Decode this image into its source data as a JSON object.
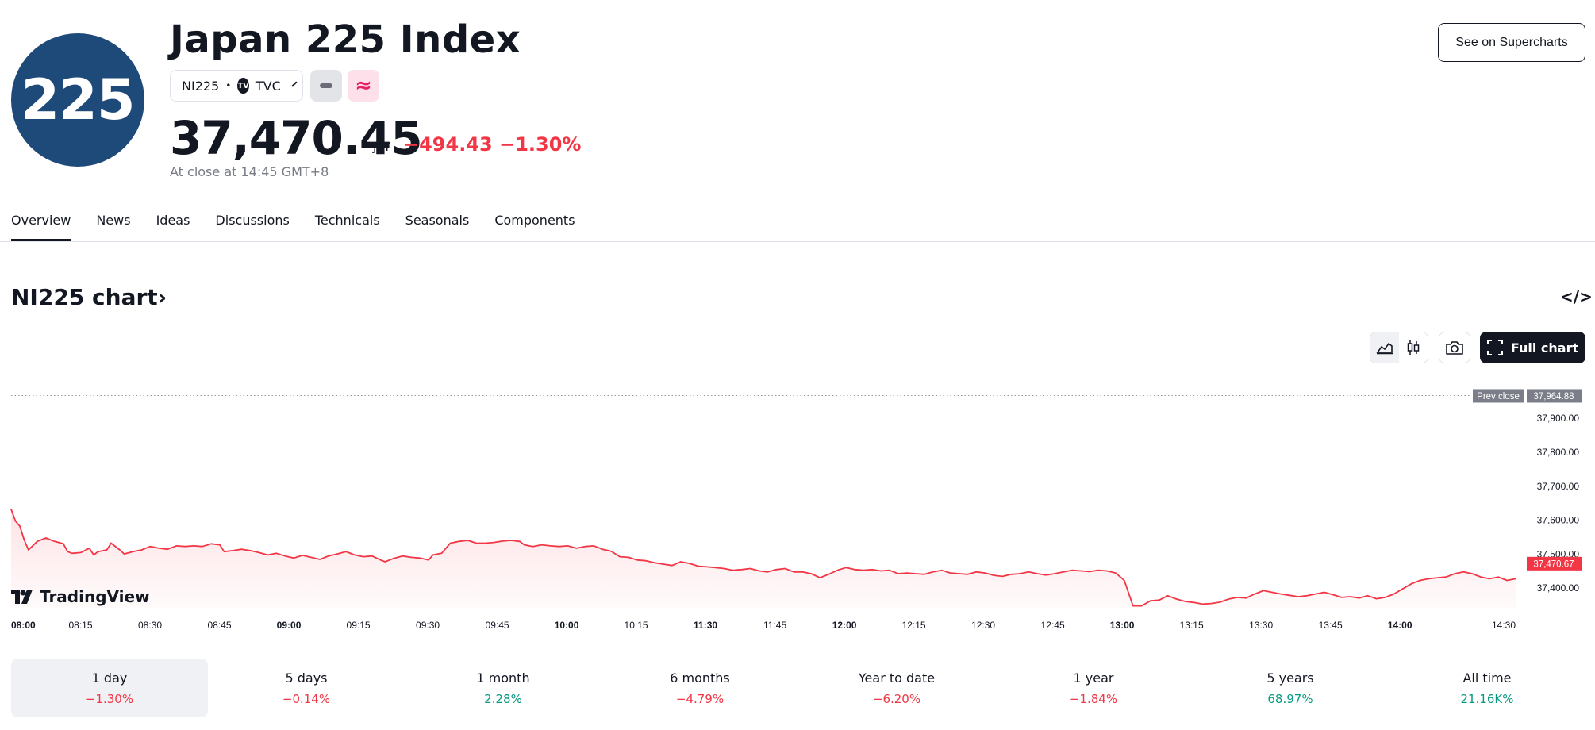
{
  "header": {
    "logo_text": "225",
    "title": "Japan 225 Index",
    "symbol": "NI225",
    "separator": "•",
    "exchange_icon": "TV",
    "exchange": "TVC",
    "supercharts_button": "See on Supercharts"
  },
  "quote": {
    "price": "37,470.45",
    "currency": "JPY",
    "change": "−494.43",
    "change_pct": "−1.30%",
    "close_note": "At close at 14:45 GMT+8",
    "accent_negative": "#f23645",
    "accent_positive": "#089981"
  },
  "tabs": [
    {
      "label": "Overview",
      "active": true
    },
    {
      "label": "News"
    },
    {
      "label": "Ideas"
    },
    {
      "label": "Discussions"
    },
    {
      "label": "Technicals"
    },
    {
      "label": "Seasonals"
    },
    {
      "label": "Components"
    }
  ],
  "chart_section": {
    "title": "NI225 chart›",
    "embed_icon": "</>",
    "full_chart_button": "Full chart",
    "watermark": "TradingView"
  },
  "chart_data": {
    "type": "area",
    "line_color": "#f23645",
    "prev_close_label": "Prev close",
    "prev_close_value": "37,964.88",
    "prev_close": 37964.88,
    "last_label": "37,470.67",
    "last": 37470.67,
    "ylim": [
      37330,
      37980
    ],
    "y_ticks": [
      {
        "value": 37900,
        "label": "37,900.00"
      },
      {
        "value": 37800,
        "label": "37,800.00"
      },
      {
        "value": 37700,
        "label": "37,700.00"
      },
      {
        "value": 37600,
        "label": "37,600.00"
      },
      {
        "value": 37500,
        "label": "37,500.00"
      },
      {
        "value": 37400,
        "label": "37,400.00"
      }
    ],
    "x_ticks": [
      {
        "t": 0,
        "label": "08:00",
        "bold": true
      },
      {
        "t": 15,
        "label": "08:15"
      },
      {
        "t": 30,
        "label": "08:30"
      },
      {
        "t": 45,
        "label": "08:45"
      },
      {
        "t": 60,
        "label": "09:00",
        "bold": true
      },
      {
        "t": 75,
        "label": "09:15"
      },
      {
        "t": 90,
        "label": "09:30"
      },
      {
        "t": 105,
        "label": "09:45"
      },
      {
        "t": 120,
        "label": "10:00",
        "bold": true
      },
      {
        "t": 135,
        "label": "10:15"
      },
      {
        "t": 150,
        "label": "11:30",
        "bold": true
      },
      {
        "t": 165,
        "label": "11:45"
      },
      {
        "t": 180,
        "label": "12:00",
        "bold": true
      },
      {
        "t": 195,
        "label": "12:15"
      },
      {
        "t": 210,
        "label": "12:30"
      },
      {
        "t": 225,
        "label": "12:45"
      },
      {
        "t": 240,
        "label": "13:00",
        "bold": true
      },
      {
        "t": 255,
        "label": "13:15"
      },
      {
        "t": 270,
        "label": "13:30"
      },
      {
        "t": 285,
        "label": "13:45"
      },
      {
        "t": 300,
        "label": "14:00",
        "bold": true
      },
      {
        "t": 325,
        "label": "14:30"
      }
    ],
    "x_range": [
      0,
      325
    ],
    "series": [
      {
        "values": [
          [
            0,
            37630
          ],
          [
            1,
            37595
          ],
          [
            2,
            37580
          ],
          [
            3,
            37540
          ],
          [
            4,
            37510
          ],
          [
            6,
            37535
          ],
          [
            8,
            37545
          ],
          [
            10,
            37535
          ],
          [
            12,
            37528
          ],
          [
            13,
            37505
          ],
          [
            14,
            37500
          ],
          [
            16,
            37502
          ],
          [
            18,
            37515
          ],
          [
            19,
            37495
          ],
          [
            20,
            37505
          ],
          [
            22,
            37510
          ],
          [
            23,
            37530
          ],
          [
            25,
            37510
          ],
          [
            26,
            37498
          ],
          [
            28,
            37505
          ],
          [
            30,
            37510
          ],
          [
            32,
            37520
          ],
          [
            34,
            37515
          ],
          [
            36,
            37512
          ],
          [
            38,
            37522
          ],
          [
            40,
            37520
          ],
          [
            42,
            37522
          ],
          [
            44,
            37520
          ],
          [
            46,
            37528
          ],
          [
            48,
            37525
          ],
          [
            49,
            37505
          ],
          [
            51,
            37508
          ],
          [
            53,
            37512
          ],
          [
            55,
            37508
          ],
          [
            57,
            37502
          ],
          [
            59,
            37495
          ],
          [
            61,
            37500
          ],
          [
            63,
            37492
          ],
          [
            65,
            37486
          ],
          [
            67,
            37494
          ],
          [
            69,
            37488
          ],
          [
            71,
            37482
          ],
          [
            73,
            37492
          ],
          [
            75,
            37498
          ],
          [
            77,
            37505
          ],
          [
            79,
            37495
          ],
          [
            81,
            37490
          ],
          [
            83,
            37492
          ],
          [
            85,
            37480
          ],
          [
            86,
            37475
          ],
          [
            88,
            37485
          ],
          [
            90,
            37492
          ],
          [
            92,
            37488
          ],
          [
            94,
            37486
          ],
          [
            96,
            37480
          ],
          [
            97,
            37495
          ],
          [
            99,
            37500
          ],
          [
            101,
            37530
          ],
          [
            103,
            37535
          ],
          [
            105,
            37538
          ],
          [
            107,
            37530
          ],
          [
            109,
            37530
          ],
          [
            111,
            37532
          ],
          [
            113,
            37536
          ],
          [
            115,
            37538
          ],
          [
            117,
            37535
          ],
          [
            118,
            37525
          ],
          [
            120,
            37520
          ],
          [
            122,
            37525
          ],
          [
            124,
            37522
          ],
          [
            126,
            37520
          ],
          [
            128,
            37522
          ],
          [
            130,
            37515
          ],
          [
            132,
            37520
          ],
          [
            134,
            37522
          ],
          [
            136,
            37512
          ],
          [
            138,
            37506
          ],
          [
            140,
            37490
          ],
          [
            142,
            37488
          ],
          [
            144,
            37480
          ],
          [
            146,
            37478
          ],
          [
            148,
            37472
          ],
          [
            150,
            37468
          ],
          [
            152,
            37464
          ],
          [
            154,
            37475
          ],
          [
            156,
            37470
          ],
          [
            158,
            37462
          ],
          [
            160,
            37460
          ],
          [
            162,
            37458
          ],
          [
            164,
            37455
          ],
          [
            166,
            37450
          ],
          [
            168,
            37452
          ],
          [
            170,
            37455
          ],
          [
            172,
            37448
          ],
          [
            174,
            37445
          ],
          [
            176,
            37452
          ],
          [
            178,
            37455
          ],
          [
            180,
            37445
          ],
          [
            182,
            37445
          ],
          [
            184,
            37440
          ],
          [
            186,
            37428
          ],
          [
            188,
            37438
          ],
          [
            190,
            37450
          ],
          [
            192,
            37458
          ],
          [
            194,
            37452
          ],
          [
            196,
            37450
          ],
          [
            198,
            37452
          ],
          [
            200,
            37448
          ],
          [
            202,
            37450
          ],
          [
            204,
            37440
          ],
          [
            206,
            37442
          ],
          [
            208,
            37440
          ],
          [
            210,
            37438
          ],
          [
            212,
            37445
          ],
          [
            214,
            37450
          ],
          [
            216,
            37442
          ],
          [
            218,
            37440
          ],
          [
            220,
            37438
          ],
          [
            222,
            37445
          ],
          [
            224,
            37442
          ],
          [
            226,
            37435
          ],
          [
            228,
            37432
          ],
          [
            230,
            37438
          ],
          [
            232,
            37440
          ],
          [
            234,
            37445
          ],
          [
            236,
            37440
          ],
          [
            238,
            37436
          ],
          [
            240,
            37440
          ],
          [
            242,
            37445
          ],
          [
            244,
            37450
          ],
          [
            246,
            37448
          ],
          [
            248,
            37446
          ],
          [
            250,
            37450
          ],
          [
            252,
            37448
          ],
          [
            254,
            37442
          ],
          [
            256,
            37420
          ],
          [
            258,
            37345
          ],
          [
            260,
            37345
          ],
          [
            262,
            37360
          ],
          [
            264,
            37362
          ],
          [
            266,
            37375
          ],
          [
            268,
            37365
          ],
          [
            270,
            37358
          ],
          [
            272,
            37355
          ],
          [
            274,
            37350
          ],
          [
            276,
            37352
          ],
          [
            278,
            37356
          ],
          [
            280,
            37365
          ],
          [
            282,
            37370
          ],
          [
            284,
            37368
          ],
          [
            286,
            37380
          ],
          [
            288,
            37390
          ],
          [
            290,
            37385
          ],
          [
            292,
            37380
          ],
          [
            294,
            37376
          ],
          [
            296,
            37372
          ],
          [
            298,
            37375
          ],
          [
            300,
            37380
          ],
          [
            302,
            37385
          ],
          [
            304,
            37378
          ],
          [
            306,
            37370
          ],
          [
            308,
            37372
          ],
          [
            310,
            37368
          ],
          [
            312,
            37375
          ],
          [
            314,
            37366
          ],
          [
            316,
            37370
          ],
          [
            318,
            37380
          ],
          [
            320,
            37395
          ],
          [
            322,
            37410
          ],
          [
            324,
            37420
          ],
          [
            326,
            37425
          ],
          [
            328,
            37428
          ],
          [
            330,
            37430
          ],
          [
            332,
            37440
          ],
          [
            334,
            37445
          ],
          [
            336,
            37440
          ],
          [
            338,
            37430
          ],
          [
            340,
            37425
          ],
          [
            342,
            37430
          ],
          [
            344,
            37420
          ],
          [
            346,
            37425
          ]
        ]
      }
    ]
  },
  "periods": [
    {
      "label": "1 day",
      "value": "−1.30%",
      "sign": "neg",
      "active": true
    },
    {
      "label": "5 days",
      "value": "−0.14%",
      "sign": "neg"
    },
    {
      "label": "1 month",
      "value": "2.28%",
      "sign": "pos"
    },
    {
      "label": "6 months",
      "value": "−4.79%",
      "sign": "neg"
    },
    {
      "label": "Year to date",
      "value": "−6.20%",
      "sign": "neg"
    },
    {
      "label": "1 year",
      "value": "−1.84%",
      "sign": "neg"
    },
    {
      "label": "5 years",
      "value": "68.97%",
      "sign": "pos"
    },
    {
      "label": "All time",
      "value": "21.16K%",
      "sign": "pos"
    }
  ]
}
